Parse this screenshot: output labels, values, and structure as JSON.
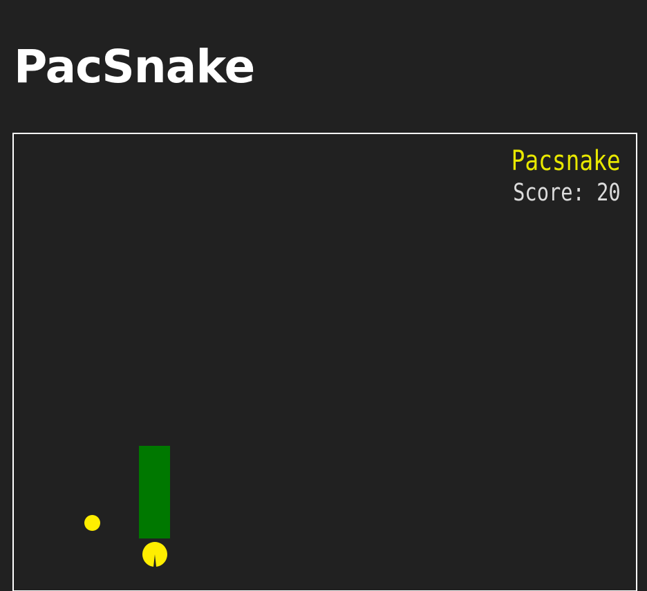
{
  "page": {
    "title": "PacSnake"
  },
  "hud": {
    "game_name": "Pacsnake",
    "score_text": "Score: 20",
    "score": 20
  },
  "sprites": {
    "snake_body": "snake-body",
    "pellet": "pellet",
    "player": "pacman-head"
  },
  "colors": {
    "background": "#212121",
    "border": "#ffffff",
    "title_text": "#ffffff",
    "hud_title": "#e8e800",
    "score_text": "#dcdcdc",
    "snake": "#007800",
    "pacman": "#ffee00",
    "pellet": "#ffee00"
  }
}
